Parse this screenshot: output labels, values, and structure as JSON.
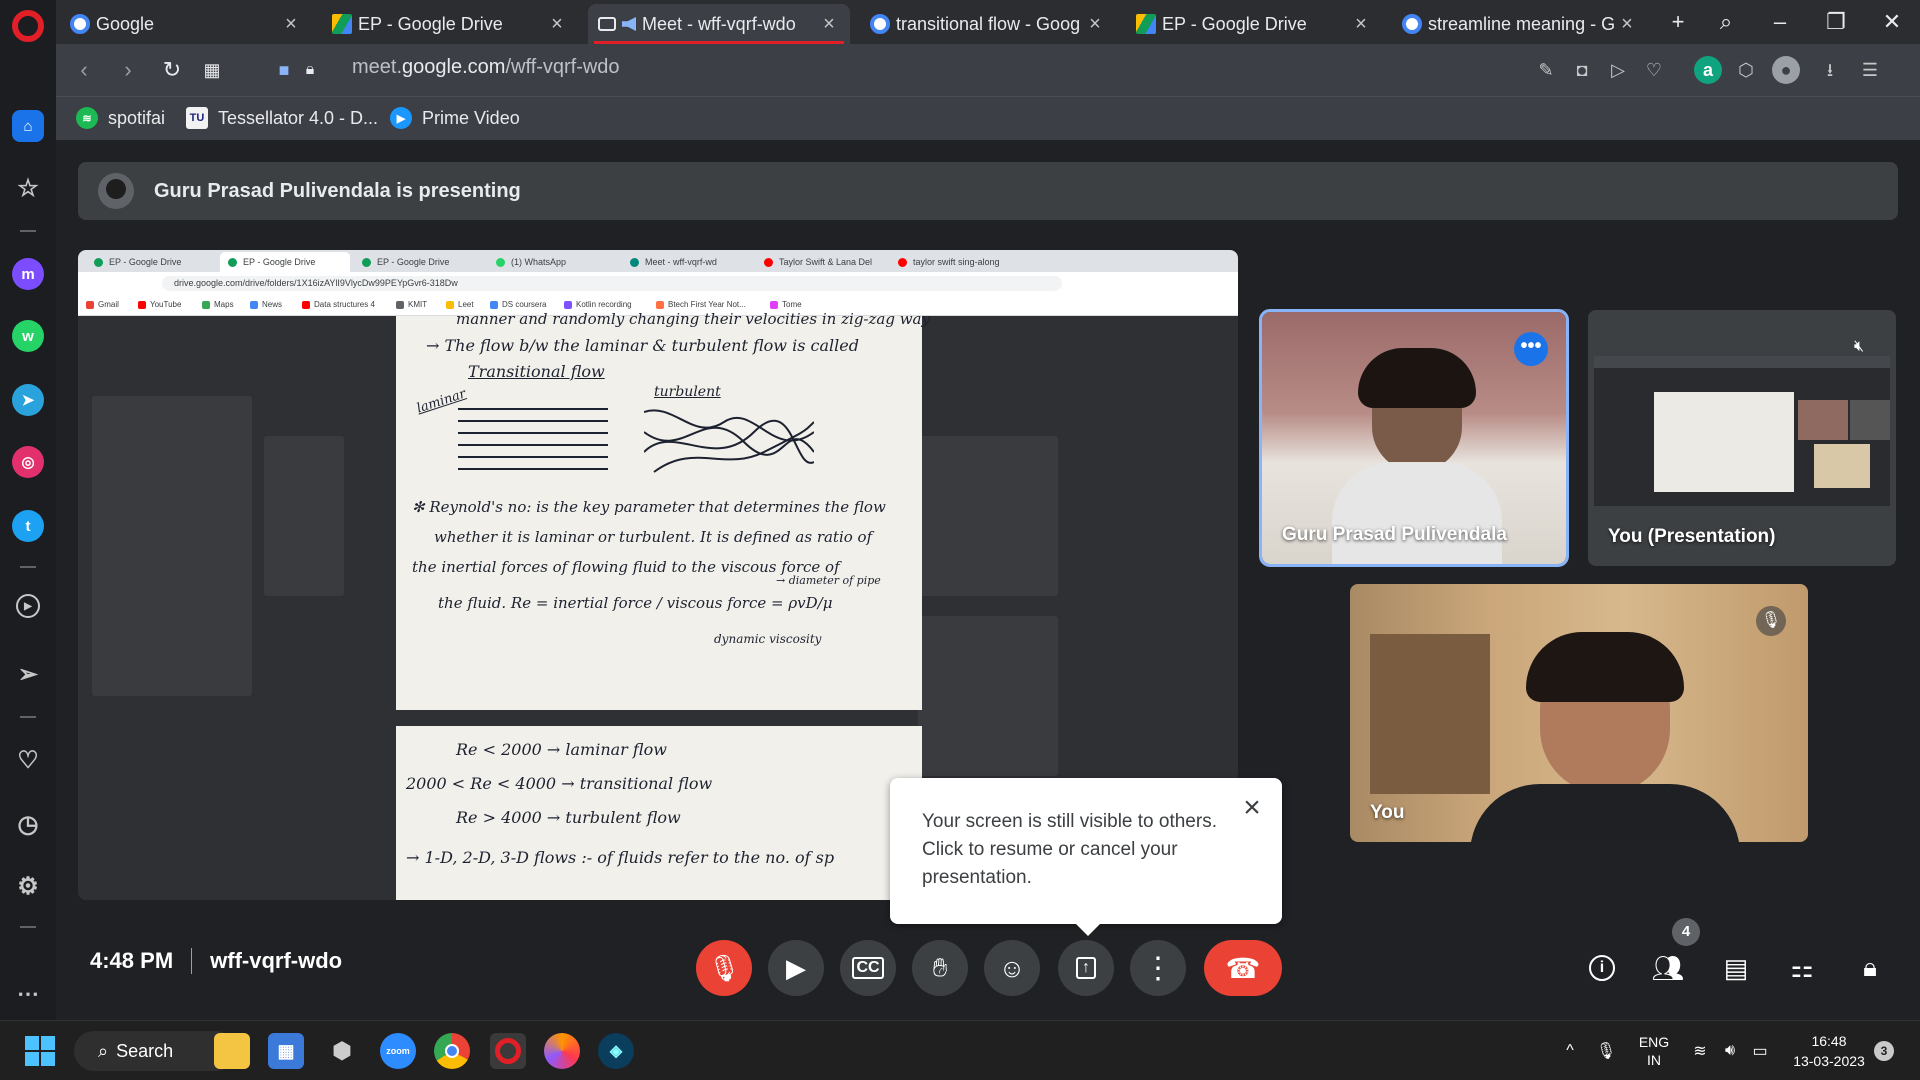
{
  "browser": {
    "tabs": [
      {
        "title": "Google",
        "icon": "google-icon",
        "color": "#4285f4"
      },
      {
        "title": "EP - Google Drive",
        "icon": "drive-icon",
        "color": "#0f9d58"
      },
      {
        "title": "Meet - wff-vqrf-wdo",
        "icon": "meet-icon",
        "color": "#00897b"
      },
      {
        "title": "transitional flow - Goog",
        "icon": "google-icon",
        "color": "#4285f4"
      },
      {
        "title": "EP - Google Drive",
        "icon": "drive-icon",
        "color": "#0f9d58"
      },
      {
        "title": "streamline meaning - G",
        "icon": "google-icon",
        "color": "#4285f4"
      }
    ],
    "url_prefix": "meet.",
    "url_domain": "google.com",
    "url_path": "/wff-vqrf-wdo",
    "bookmarks": [
      "spotifai",
      "Tessellator 4.0 - D...",
      "Prime Video"
    ]
  },
  "meet": {
    "presenting_banner": "Guru Prasad Pulivendala is presenting",
    "inner_browser": {
      "tabs": [
        "EP - Google Drive",
        "EP - Google Drive",
        "EP - Google Drive",
        "(1) WhatsApp",
        "Meet - wff-vqrf-wd",
        "Taylor Swift & Lana Del",
        "taylor swift sing-along"
      ],
      "url": "drive.google.com/drive/folders/1X16izAYlI9VlycDw99PEYpGvr6-318Dw",
      "bookmarks": [
        "Gmail",
        "YouTube",
        "Maps",
        "News",
        "Data structures 4",
        "KMIT",
        "Leet",
        "DS coursera",
        "Kotlin recording",
        "Btech First Year Not...",
        "Tome"
      ]
    },
    "notes": {
      "lines": [
        "manner and randomly changing their velocities in zig-zag way",
        "→ The flow b/w the laminar & turbulent flow is called",
        "Transitional flow",
        "laminar",
        "turbulent",
        "✻ Reynold's no: is the key parameter that determines the flow",
        "whether it is laminar or turbulent. It is defined as ratio of",
        "the inertial forces of flowing fluid to the viscous force of",
        "the fluid. Re = inertial force / viscous force = ρvD/μ",
        "→ diameter of pipe",
        "dynamic viscosity",
        "Re < 2000 → laminar flow",
        "2000 < Re < 4000 → transitional flow",
        "Re > 4000 → turbulent flow",
        "→ 1-D, 2-D, 3-D flows :- of fluids refer to the no. of sp"
      ]
    },
    "participants": [
      {
        "name": "Guru Prasad Pulivendala",
        "speaking": true
      },
      {
        "name": "You (Presentation)",
        "muted": true
      },
      {
        "name": "You",
        "muted": true
      }
    ],
    "popup": {
      "text": "Your screen is still visible to others. Click to resume or cancel your presentation."
    },
    "time": "4:48 PM",
    "meeting_code": "wff-vqrf-wdo",
    "participant_count": "4",
    "colors": {
      "accent_blue": "#1a73e8",
      "danger_red": "#ea4335",
      "opera_red": "#e01f26"
    }
  },
  "taskbar": {
    "search_label": "Search",
    "lang_top": "ENG",
    "lang_bottom": "IN",
    "clock_time": "16:48",
    "clock_date": "13-03-2023",
    "notification_count": "3"
  }
}
